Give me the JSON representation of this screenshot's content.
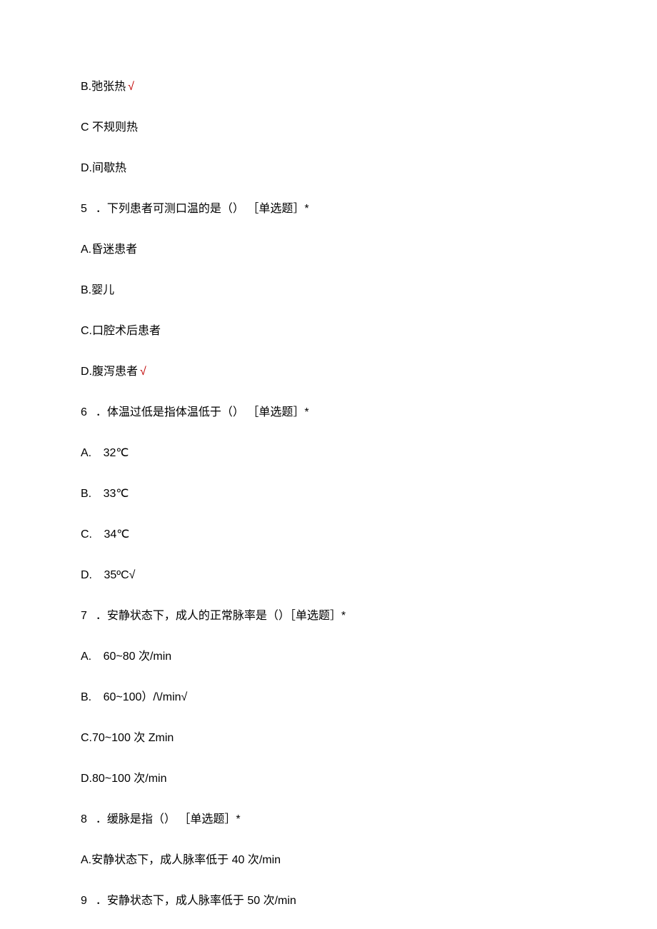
{
  "lines": {
    "l1_label": "B.",
    "l1_text": "弛张热",
    "l1_check": "√",
    "l2_label": "C",
    "l2_text": "不规则热",
    "l3_label": "D.",
    "l3_text": "间歇热",
    "q5_num": "5",
    "q5_text": "．下列患者可测口温的是（） ［单选题］*",
    "q5a_label": "A.",
    "q5a_text": "昏迷患者",
    "q5b_label": "B.",
    "q5b_text": "婴儿",
    "q5c_label": "C.",
    "q5c_text": "口腔术后患者",
    "q5d_label": "D.",
    "q5d_text": "腹泻患者",
    "q5d_check": "√",
    "q6_num": "6",
    "q6_text": "．体温过低是指体温低于（） ［单选题］*",
    "q6a_label": "A.",
    "q6a_text": "32℃",
    "q6b_label": "B.",
    "q6b_text": "33℃",
    "q6c_label": "C.",
    "q6c_text": "34℃",
    "q6d_label": "D.",
    "q6d_text": "35ºC√",
    "q7_num": "7",
    "q7_text": "．安静状态下，成人的正常脉率是（）［单选题］*",
    "q7a_label": "A.",
    "q7a_text": "60~80 次/min",
    "q7b_label": "B.",
    "q7b_text": "60~100）/\\/min√",
    "q7c_label": "C.",
    "q7c_text": "70~100 次 Zmin",
    "q7d_label": "D.",
    "q7d_text": "80~100 次/min",
    "q8_num": "8",
    "q8_text": "．缓脉是指（） ［单选题］*",
    "q8a_label": "A.",
    "q8a_text": "安静状态下，成人脉率低于 40 次/min",
    "q9_num": "9",
    "q9_text": "．安静状态下，成人脉率低于 50 次/min"
  }
}
